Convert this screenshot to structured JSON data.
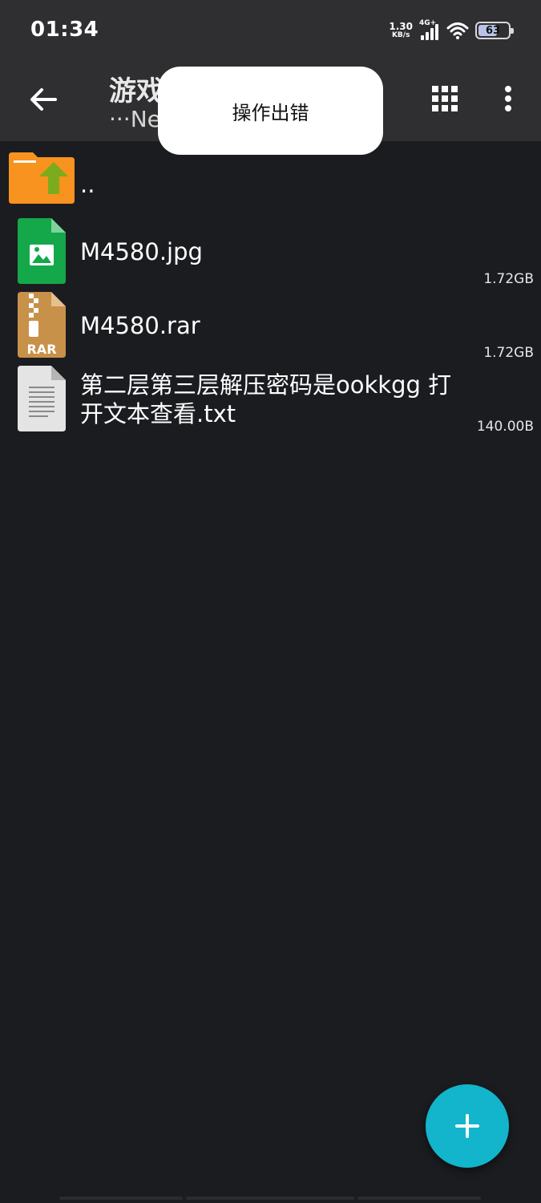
{
  "status_bar": {
    "time": "01:34",
    "net_speed": "1.30",
    "net_speed_unit": "KB/s",
    "network_type": "4G+",
    "battery_level": "63",
    "battery_fraction": 0.63
  },
  "app_bar": {
    "title": "游戏",
    "subtitle": "···Ne",
    "back_icon": "arrow-left-icon",
    "view_toggle_icon": "grid-icon",
    "overflow_icon": "more-vert-icon"
  },
  "toast": {
    "message": "操作出错"
  },
  "files": [
    {
      "name": "..",
      "size": "",
      "icon": "folder-up-icon"
    },
    {
      "name": "M4580.jpg",
      "size": "1.72GB",
      "icon": "image-file-icon"
    },
    {
      "name": "M4580.rar",
      "size": "1.72GB",
      "icon": "rar-archive-icon",
      "badge": "RAR"
    },
    {
      "name": "第二层第三层解压密码是ookkgg  打开文本查看.txt",
      "name_line1": "第二层第三层解压密码是ookkgg  打",
      "name_line2": "开文本查看.txt",
      "size": "140.00B",
      "icon": "text-file-icon"
    }
  ],
  "fab": {
    "icon": "plus-icon"
  },
  "colors": {
    "background": "#1b1c20",
    "bar": "#2f2f31",
    "accent": "#12b5cb",
    "folder": "#f7931e",
    "image_file": "#14a84b",
    "archive": "#c8914a"
  }
}
